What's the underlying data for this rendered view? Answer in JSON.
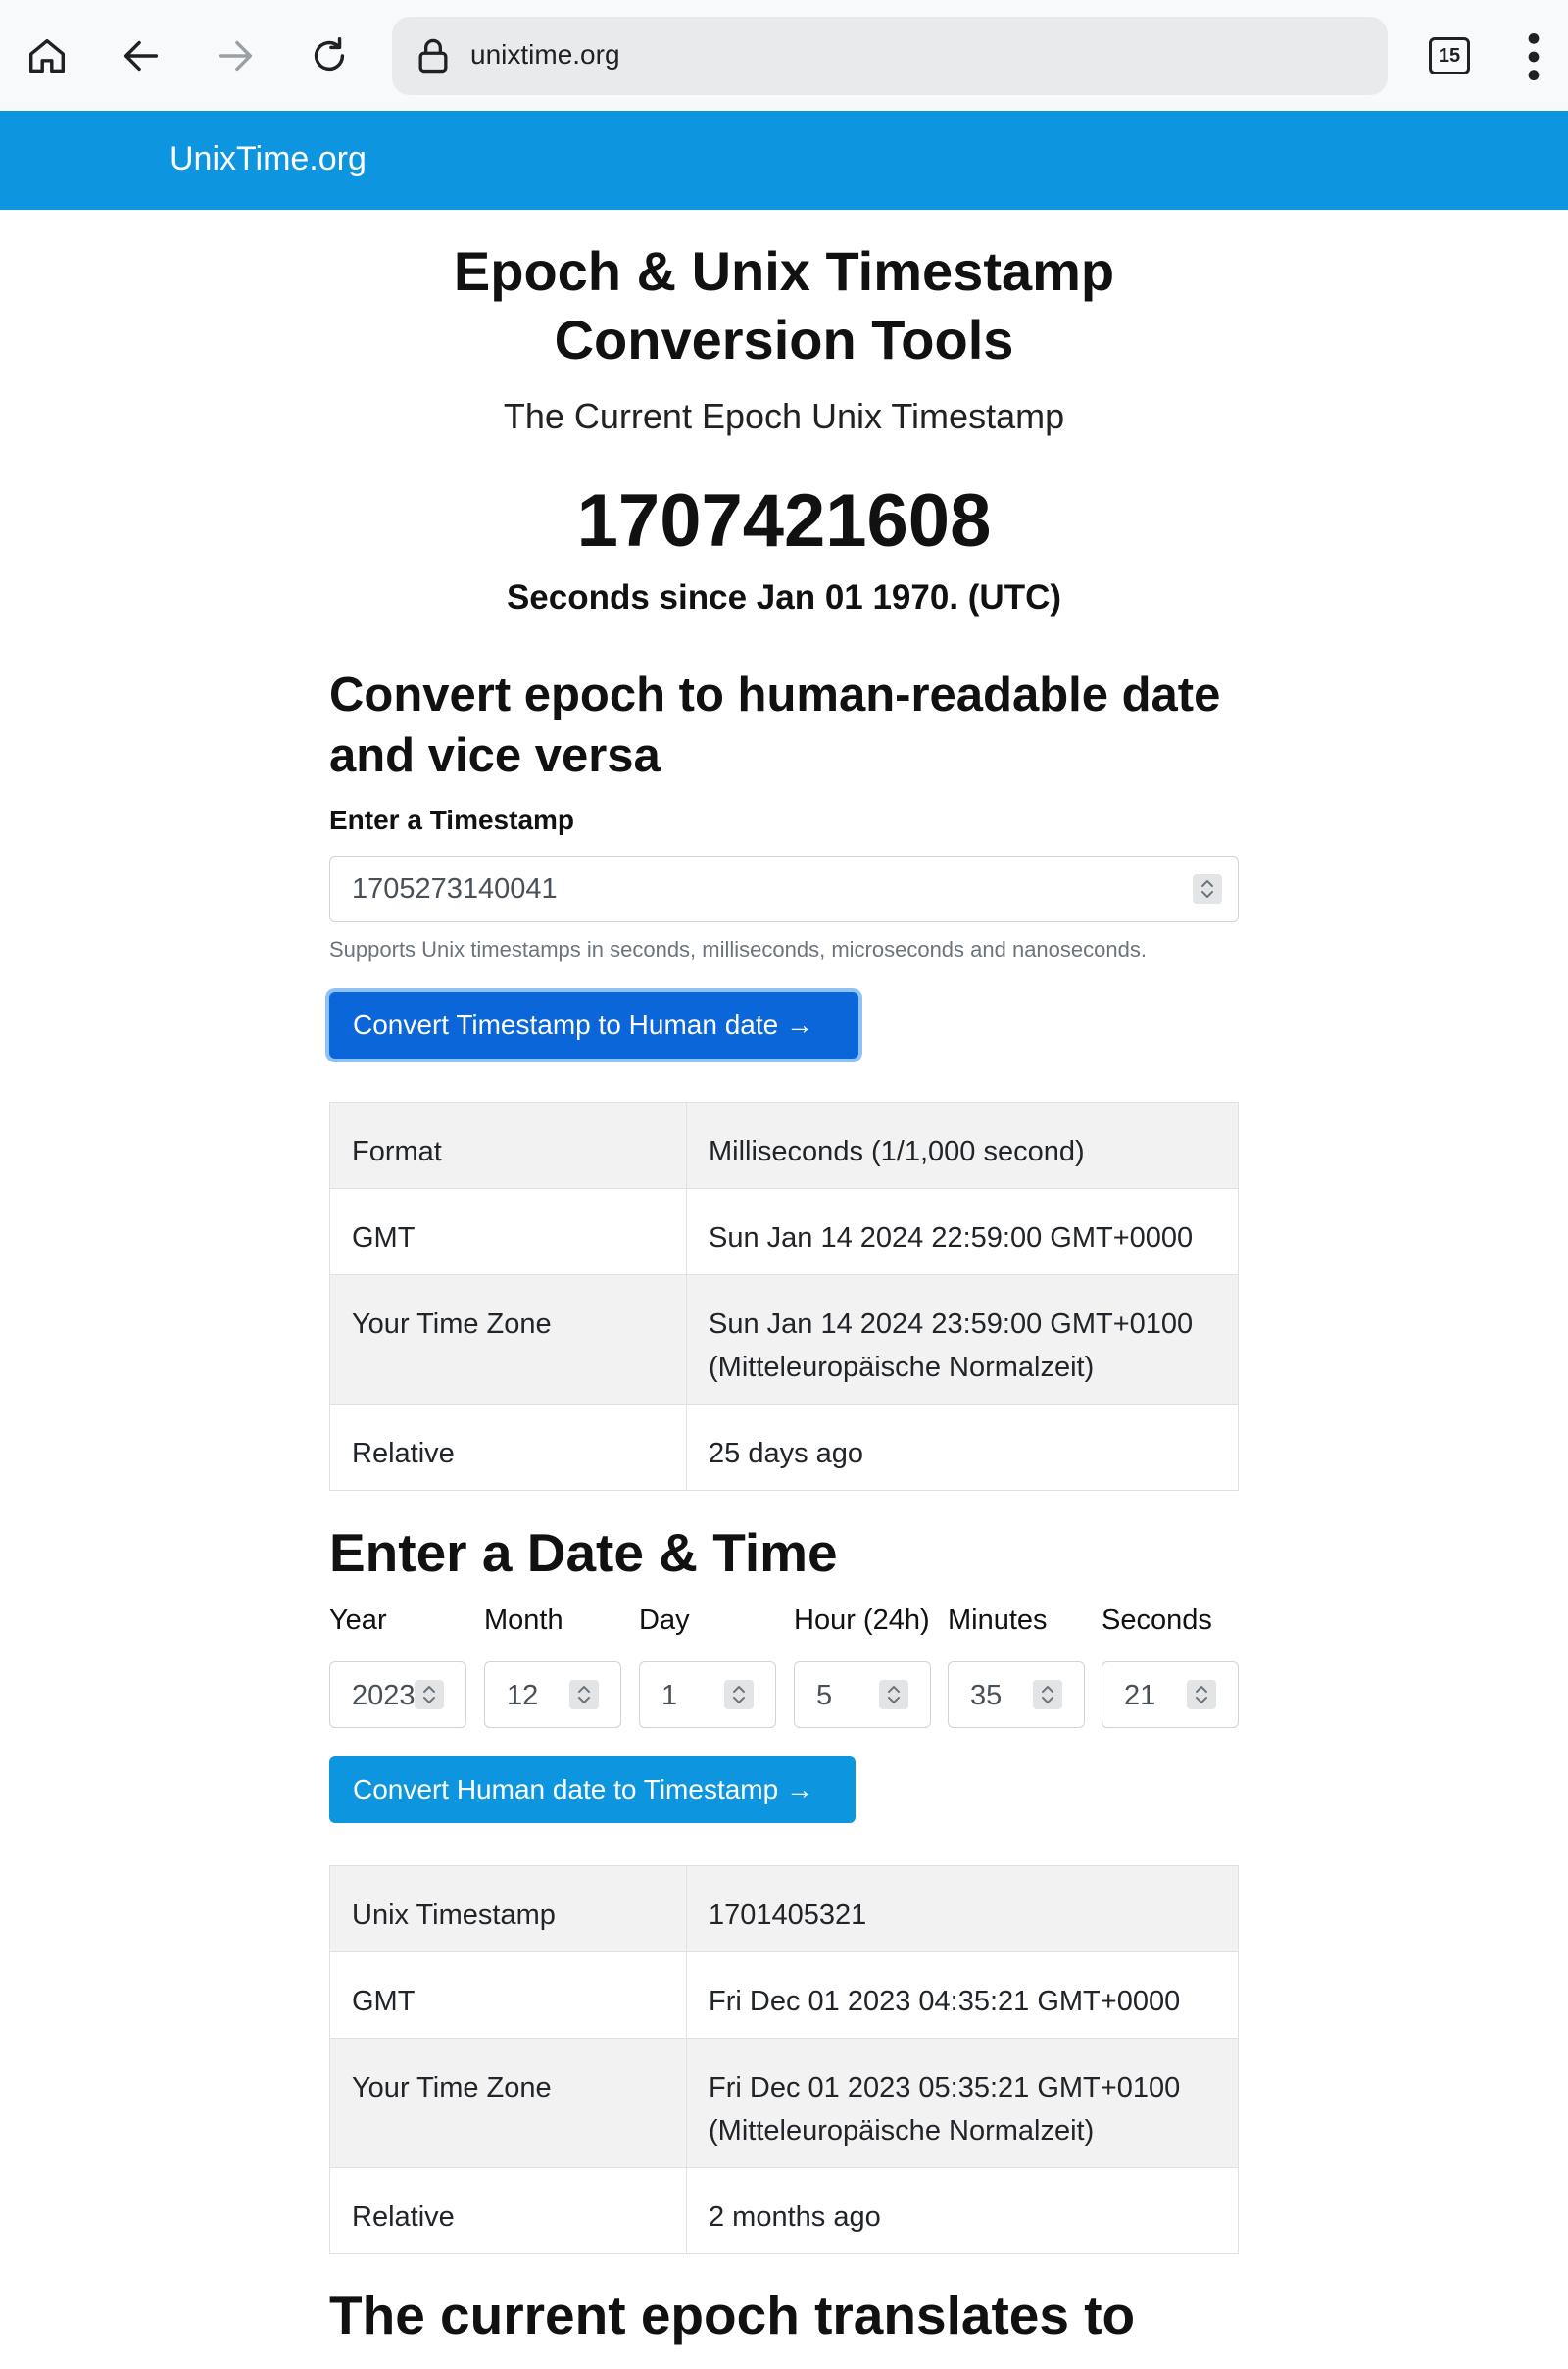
{
  "browser": {
    "url": "unixtime.org",
    "tab_count": "15"
  },
  "site": {
    "brand": "UnixTime.org"
  },
  "hero": {
    "title_line1": "Epoch & Unix Timestamp",
    "title_line2": "Conversion Tools",
    "lead": "The Current Epoch Unix Timestamp",
    "current_timestamp": "1707421608",
    "since_label": "Seconds since Jan 01 1970. (UTC)"
  },
  "epoch_to_date": {
    "heading_line1": "Convert epoch to human-readable date",
    "heading_line2": "and vice versa",
    "input_label": "Enter a Timestamp",
    "input_value": "1705273140041",
    "help_text": "Supports Unix timestamps in seconds, milliseconds, microseconds and nanoseconds.",
    "button_label": "Convert Timestamp to Human date →",
    "result": {
      "format_key": "Format",
      "format_value": "Milliseconds (1/1,000 second)",
      "gmt_key": "GMT",
      "gmt_value": "Sun Jan 14 2024 22:59:00 GMT+0000",
      "tz_key": "Your Time Zone",
      "tz_value_line1": "Sun Jan 14 2024 23:59:00 GMT+0100",
      "tz_value_line2": "(Mitteleuropäische Normalzeit)",
      "relative_key": "Relative",
      "relative_value": "25 days ago"
    }
  },
  "date_to_epoch": {
    "heading": "Enter a Date & Time",
    "fields": {
      "year_label": "Year",
      "year_value": "2023",
      "month_label": "Month",
      "month_value": "12",
      "day_label": "Day",
      "day_value": "1",
      "hour_label": "Hour (24h)",
      "hour_value": "5",
      "minutes_label": "Minutes",
      "minutes_value": "35",
      "seconds_label": "Seconds",
      "seconds_value": "21"
    },
    "button_label": "Convert Human date to Timestamp →",
    "result": {
      "ts_key": "Unix Timestamp",
      "ts_value": "1701405321",
      "gmt_key": "GMT",
      "gmt_value": "Fri Dec 01 2023 04:35:21 GMT+0000",
      "tz_key": "Your Time Zone",
      "tz_value_line1": "Fri Dec 01 2023 05:35:21 GMT+0100",
      "tz_value_line2": "(Mitteleuropäische Normalzeit)",
      "relative_key": "Relative",
      "relative_value": "2 months ago"
    }
  },
  "current_epoch": {
    "heading": "The current epoch translates to"
  }
}
